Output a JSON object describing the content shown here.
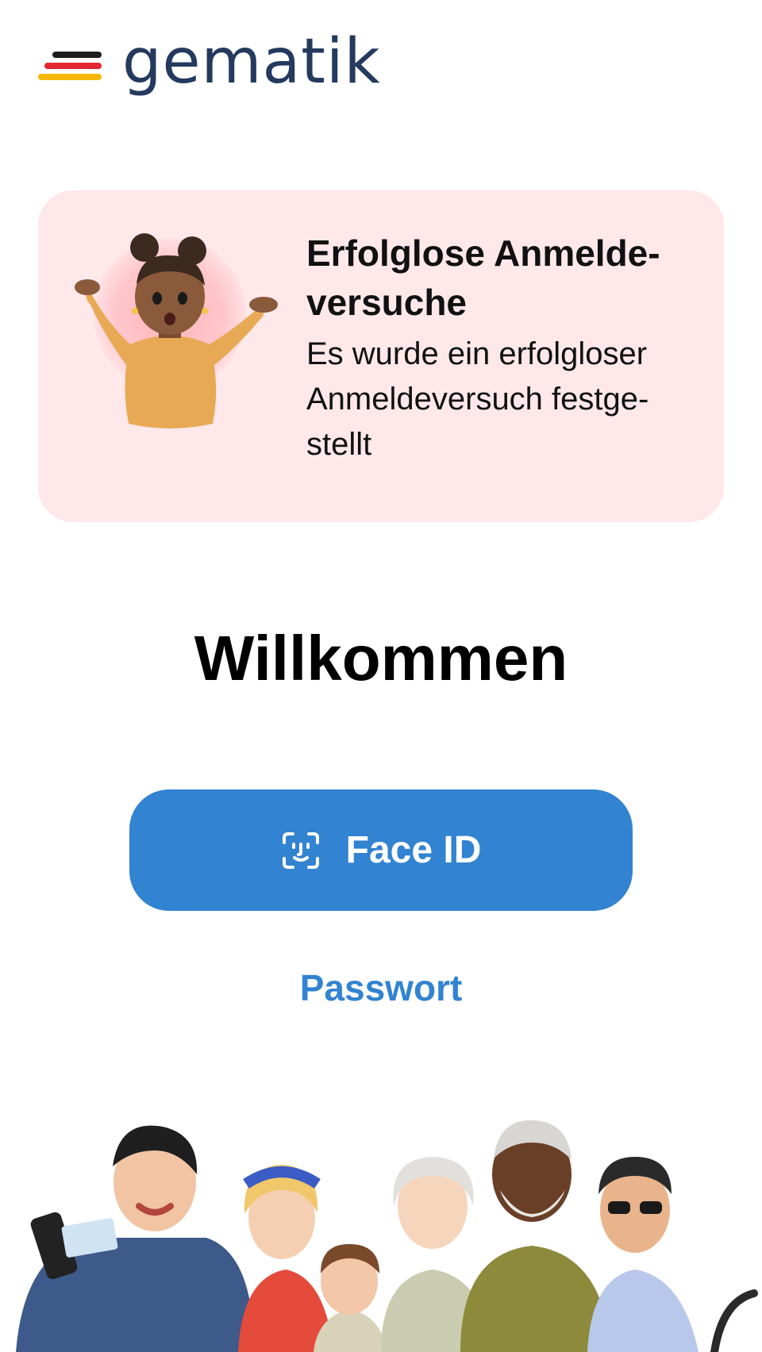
{
  "logo": {
    "text": "gematik",
    "colors": {
      "black": "#1c1c1c",
      "red": "#e3262f",
      "gold": "#f5b800",
      "text": "#243a5e"
    }
  },
  "alert": {
    "title": "Erfolglose Anmelde-versuche",
    "body": "Es wurde ein erfolgloser Anmeldeversuch festge-stellt",
    "background": "#ffe8ea",
    "illustration": "shrugging-person-illustration"
  },
  "welcome": {
    "title": "Willkommen"
  },
  "actions": {
    "faceid_label": "Face ID",
    "faceid_icon": "face-id-icon",
    "password_label": "Passwort",
    "accent_color": "#3283d1"
  },
  "footer": {
    "illustration": "group-of-people-illustration"
  }
}
